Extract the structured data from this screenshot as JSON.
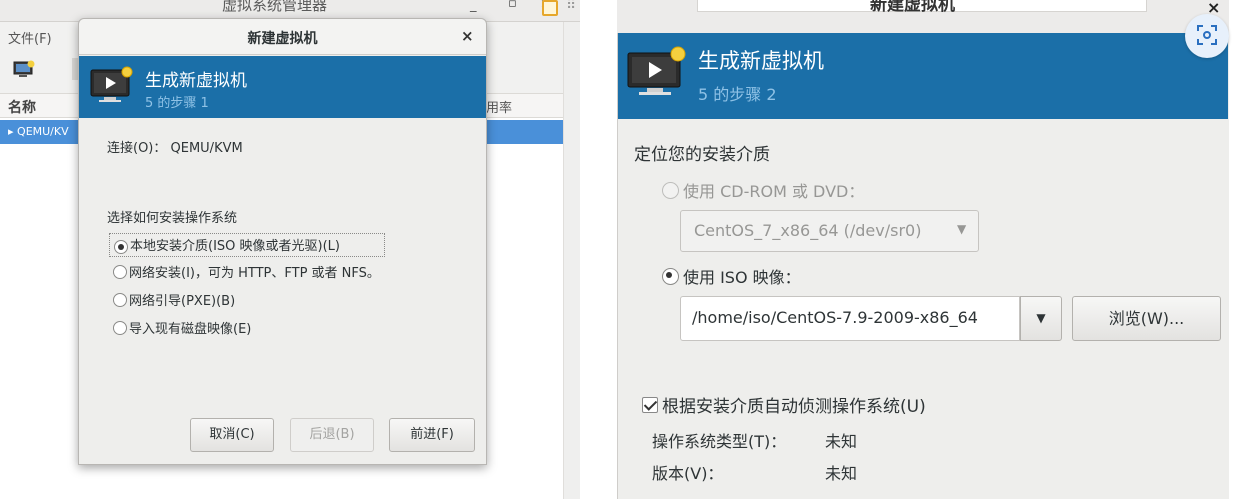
{
  "manager": {
    "title": "虚拟系统管理器",
    "menu_file": "文件(F)",
    "column_name": "名称",
    "column_rate": "用率",
    "row_label": "QEMU/KV"
  },
  "dialog1": {
    "title": "新建虚拟机",
    "banner_title": "生成新虚拟机",
    "banner_step": "5 的步骤 1",
    "connection": "连接(O)： QEMU/KVM",
    "section_label": "选择如何安装操作系统",
    "options": [
      {
        "label": "本地安装介质(ISO 映像或者光驱)(L)",
        "selected": true
      },
      {
        "label": "网络安装(I)，可为 HTTP、FTP 或者 NFS。",
        "selected": false
      },
      {
        "label": "网络引导(PXE)(B)",
        "selected": false
      },
      {
        "label": "导入现有磁盘映像(E)",
        "selected": false
      }
    ],
    "buttons": {
      "cancel": "取消(C)",
      "back": "后退(B)",
      "forward": "前进(F)"
    }
  },
  "dialog2": {
    "title": "新建虚拟机",
    "banner_title": "生成新虚拟机",
    "banner_step": "5 的步骤 2",
    "section_label": "定位您的安装介质",
    "use_cdrom_label": "使用  CD-ROM 或  DVD：",
    "cdrom_value": "CentOS_7_x86_64 (/dev/sr0)",
    "use_iso_label": "使用  ISO 映像：",
    "iso_path": "/home/iso/CentOS-7.9-2009-x86_64",
    "browse_label": "浏览(W)...",
    "autodetect_label": "根据安装介质自动侦测操作系统(U)",
    "os_type_label": "操作系统类型(T)：",
    "os_type_value": "未知",
    "version_label": "版本(V)：",
    "version_value": "未知"
  },
  "colors": {
    "banner": "#1b6fa8",
    "selection": "#4a90d9"
  }
}
